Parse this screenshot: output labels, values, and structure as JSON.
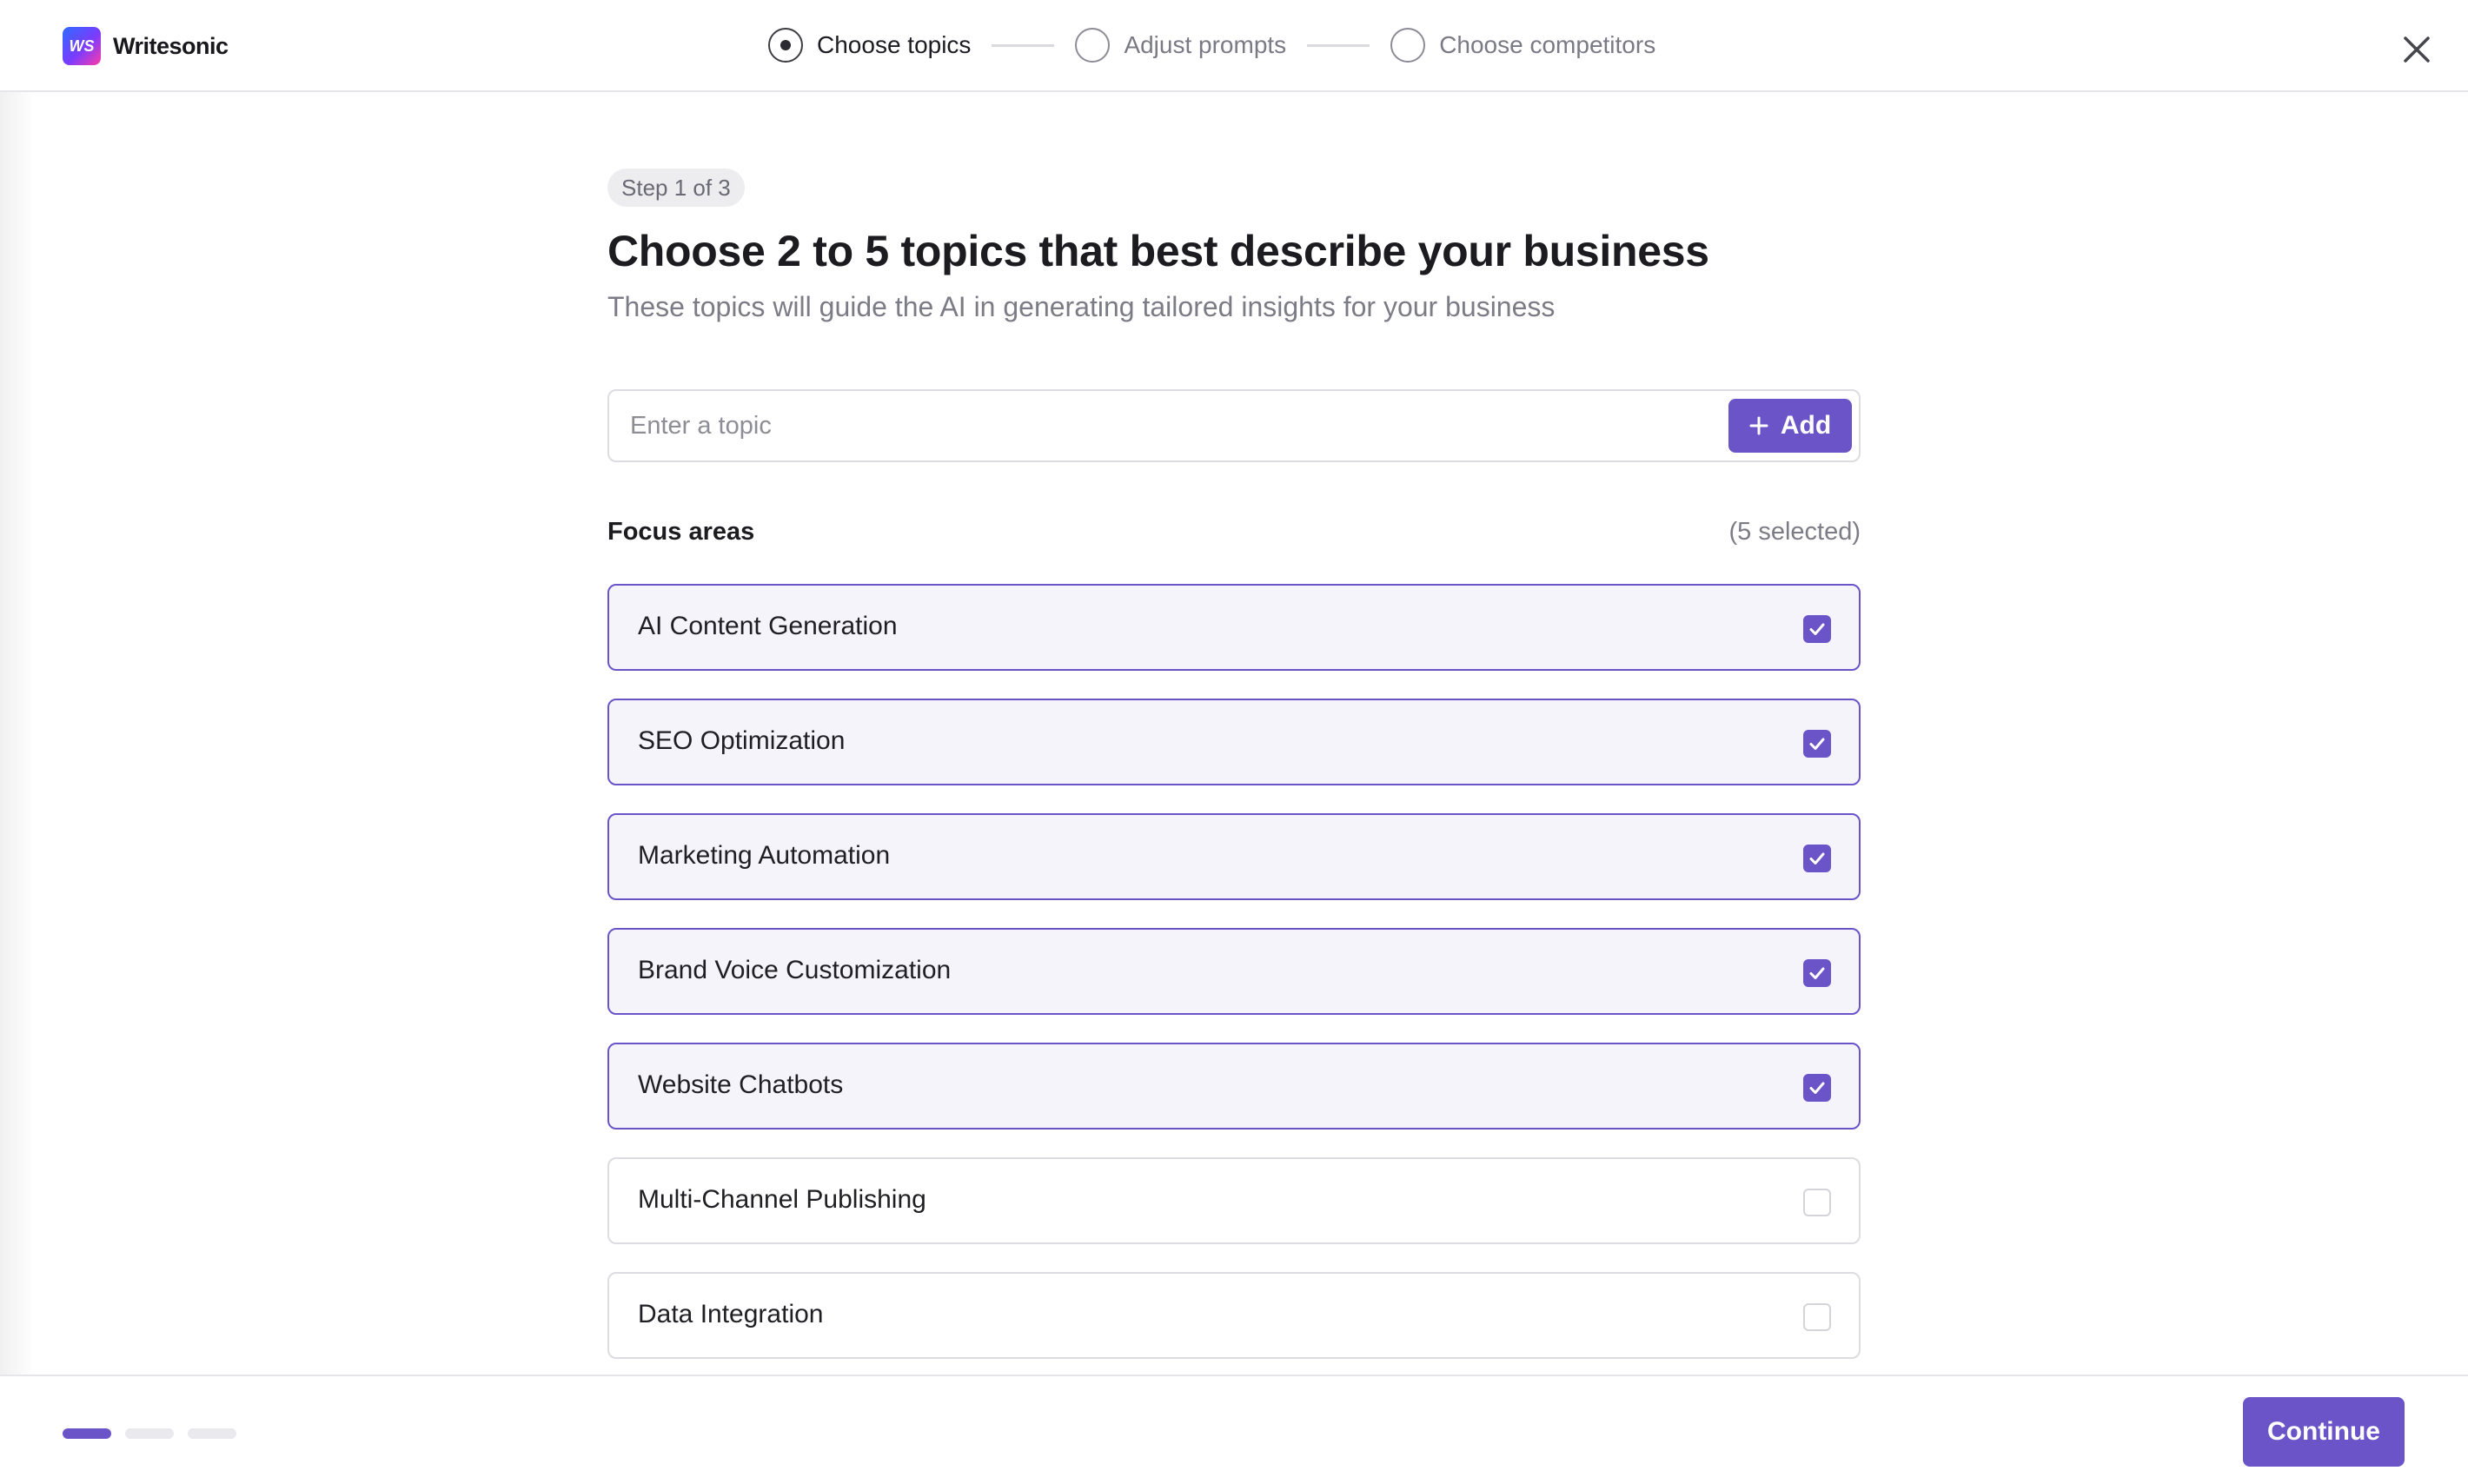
{
  "brand": {
    "logo_text": "WS",
    "name": "Writesonic"
  },
  "stepper": {
    "steps": [
      {
        "label": "Choose topics",
        "state": "active"
      },
      {
        "label": "Adjust prompts",
        "state": "upcoming"
      },
      {
        "label": "Choose competitors",
        "state": "upcoming"
      }
    ]
  },
  "main": {
    "step_pill": "Step 1 of 3",
    "title": "Choose 2 to 5 topics that best describe your business",
    "subtitle": "These topics will guide the AI in generating tailored insights for your business",
    "topic_input": {
      "placeholder": "Enter a topic",
      "value": ""
    },
    "add_label": "Add",
    "focus_title": "Focus areas",
    "focus_count": "(5 selected)",
    "topics": [
      {
        "label": "AI Content Generation",
        "selected": true
      },
      {
        "label": "SEO Optimization",
        "selected": true
      },
      {
        "label": "Marketing Automation",
        "selected": true
      },
      {
        "label": "Brand Voice Customization",
        "selected": true
      },
      {
        "label": "Website Chatbots",
        "selected": true
      },
      {
        "label": "Multi-Channel Publishing",
        "selected": false
      },
      {
        "label": "Data Integration",
        "selected": false
      }
    ]
  },
  "footer": {
    "progress": {
      "total": 3,
      "current": 1
    },
    "continue_label": "Continue"
  },
  "colors": {
    "accent": "#6b54c8",
    "selected_bg": "#f5f4fb",
    "border": "#dcdce2"
  }
}
